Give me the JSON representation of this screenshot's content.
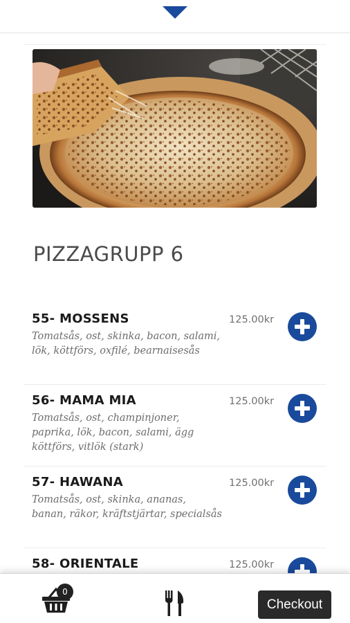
{
  "header": {
    "collapse_icon": "caret-down-icon",
    "accent": "#1a4a9c"
  },
  "hero": {
    "image": "pizza-photo"
  },
  "group": {
    "title": "PIZZAGRUPP 6"
  },
  "menu": {
    "items": [
      {
        "name": "55- MOSSENS",
        "description": "Tomatsås, ost, skinka, bacon, salami, lök, köttförs, oxfilé, bearnaisesås",
        "price": "125.00kr"
      },
      {
        "name": "56- MAMA MIA",
        "description": "Tomatsås, ost, champinjoner, paprika, lök, bacon, salami, ägg köttförs, vitlök (stark)",
        "price": "125.00kr"
      },
      {
        "name": "57- HAWANA",
        "description": "Tomatsås, ost, skinka, ananas, banan, räkor, kräftstjärtar, specialsås",
        "price": "125.00kr"
      },
      {
        "name": "58- ORIENTALE",
        "description": "",
        "price": "125.00kr"
      }
    ],
    "add_icon": "plus-circle-icon"
  },
  "bottom_nav": {
    "basket_icon": "basket-icon",
    "basket_count": "0",
    "menu_icon": "fork-knife-icon",
    "checkout_label": "Checkout"
  }
}
